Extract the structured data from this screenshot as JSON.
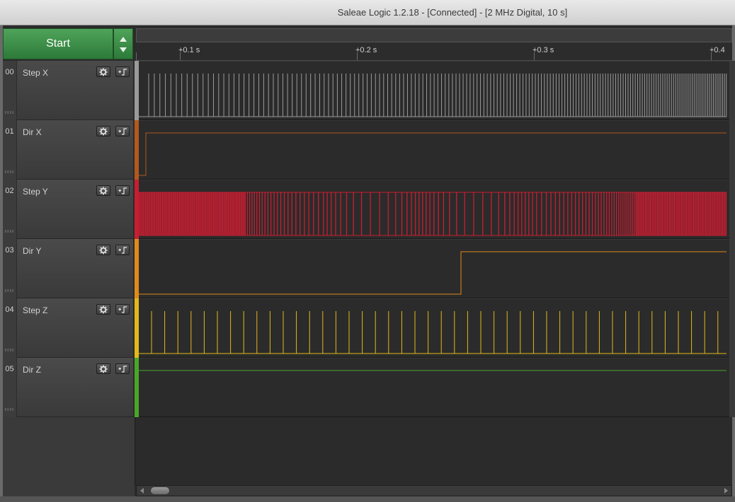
{
  "window": {
    "title": "Saleae Logic 1.2.18 - [Connected] - [2 MHz Digital, 10 s]"
  },
  "toolbar": {
    "start_label": "Start"
  },
  "ruler": {
    "ticks": [
      "+0.1 s",
      "+0.2 s",
      "+0.3 s",
      "+0.4"
    ]
  },
  "channels": [
    {
      "num": "00",
      "name": "Step X",
      "color": "#9a9a9a"
    },
    {
      "num": "01",
      "name": "Dir X",
      "color": "#b2591e"
    },
    {
      "num": "02",
      "name": "Step Y",
      "color": "#c81e32"
    },
    {
      "num": "03",
      "name": "Dir Y",
      "color": "#e08a1c"
    },
    {
      "num": "04",
      "name": "Step Z",
      "color": "#e2b81a"
    },
    {
      "num": "05",
      "name": "Dir Z",
      "color": "#4aa62a"
    }
  ],
  "icons": {
    "settings": "gear-icon",
    "trigger": "trigger-edge-icon"
  }
}
